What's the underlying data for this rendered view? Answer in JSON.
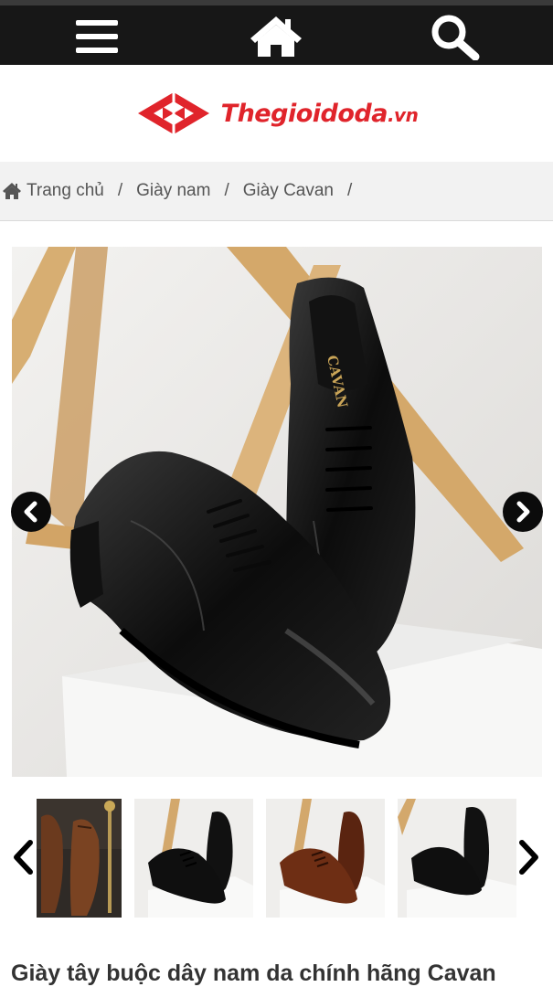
{
  "header": {
    "menu_icon": "hamburger-menu-icon",
    "home_icon": "home-icon",
    "search_icon": "search-icon",
    "bar_color": "#171717"
  },
  "logo": {
    "name": "Thegioidoda",
    "tld": ".vn",
    "color": "#e0242b"
  },
  "breadcrumb": {
    "items": [
      {
        "label": "Trang chủ",
        "icon": "home-icon"
      },
      {
        "label": "Giày nam"
      },
      {
        "label": "Giày Cavan"
      }
    ],
    "separator": "/"
  },
  "gallery": {
    "main_image": "black-leather-oxford-shoes-photo",
    "brand_print": "CAVAN",
    "prev_icon": "chevron-left-icon",
    "next_icon": "chevron-right-icon",
    "thumbnails": [
      {
        "name": "brown-oxford-pair"
      },
      {
        "name": "black-oxford-pair"
      },
      {
        "name": "brown-oxford-on-block"
      },
      {
        "name": "black-oxford-on-block"
      }
    ]
  },
  "product": {
    "title": "Giày tây buộc dây nam da chính hãng Cavan"
  }
}
